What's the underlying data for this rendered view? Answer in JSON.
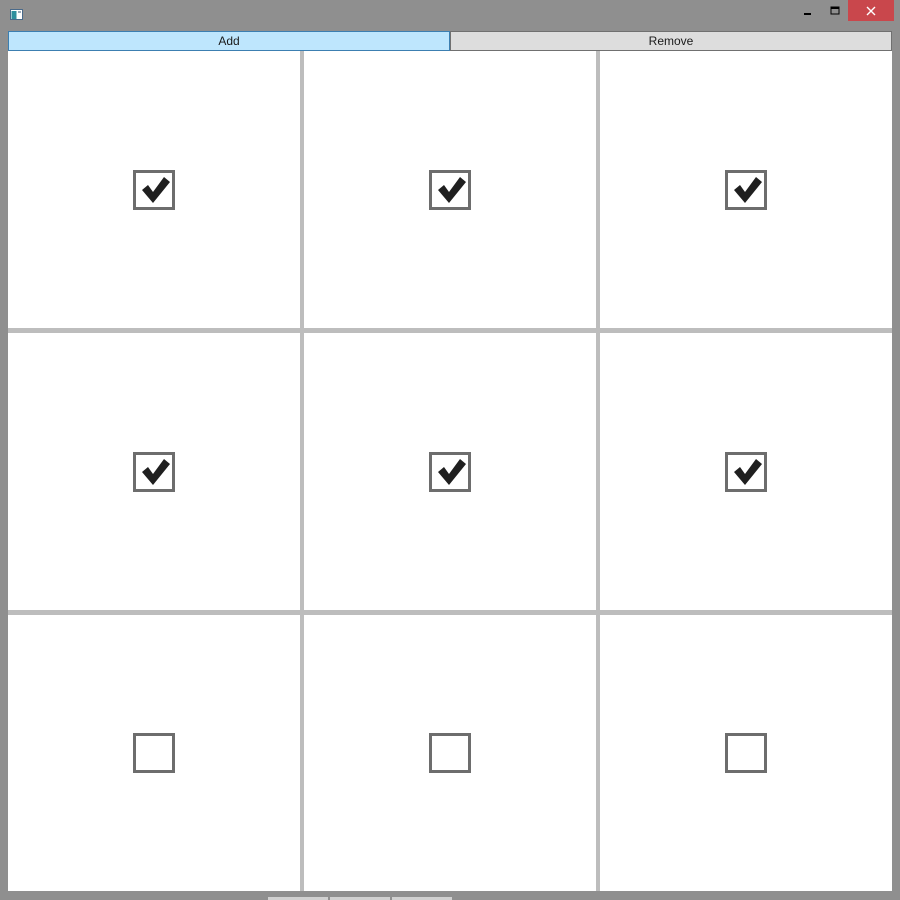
{
  "window": {
    "title": "",
    "colors": {
      "frame": "#8f8f8f",
      "close_button": "#c9474c",
      "grid_gap": "#bdbdbd",
      "add_button_bg": "#bee6fd",
      "remove_button_bg": "#dddddd"
    },
    "caption_buttons": {
      "minimize": "minimize-icon",
      "maximize": "maximize-icon",
      "close": "close-icon"
    }
  },
  "toolbar": {
    "add_label": "Add",
    "remove_label": "Remove"
  },
  "grid": {
    "rows": 3,
    "columns": 3,
    "cells": [
      {
        "checked": true
      },
      {
        "checked": true
      },
      {
        "checked": true
      },
      {
        "checked": true
      },
      {
        "checked": true
      },
      {
        "checked": true
      },
      {
        "checked": false
      },
      {
        "checked": false
      },
      {
        "checked": false
      }
    ]
  }
}
